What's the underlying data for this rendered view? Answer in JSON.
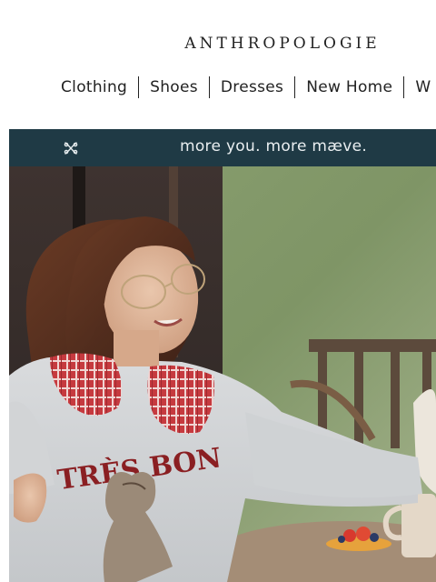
{
  "header": {
    "logo": "ANTHROPOLOGIE"
  },
  "nav": {
    "items": [
      {
        "label": "Clothing"
      },
      {
        "label": "Shoes"
      },
      {
        "label": "Dresses"
      },
      {
        "label": "New Home"
      },
      {
        "label": "W"
      }
    ]
  },
  "banner": {
    "text": "more you. more mæve.",
    "icon": "maeve-logo-icon",
    "background": "#1f3a45"
  },
  "hero": {
    "sweatshirt_text": "TRÈS BON"
  }
}
